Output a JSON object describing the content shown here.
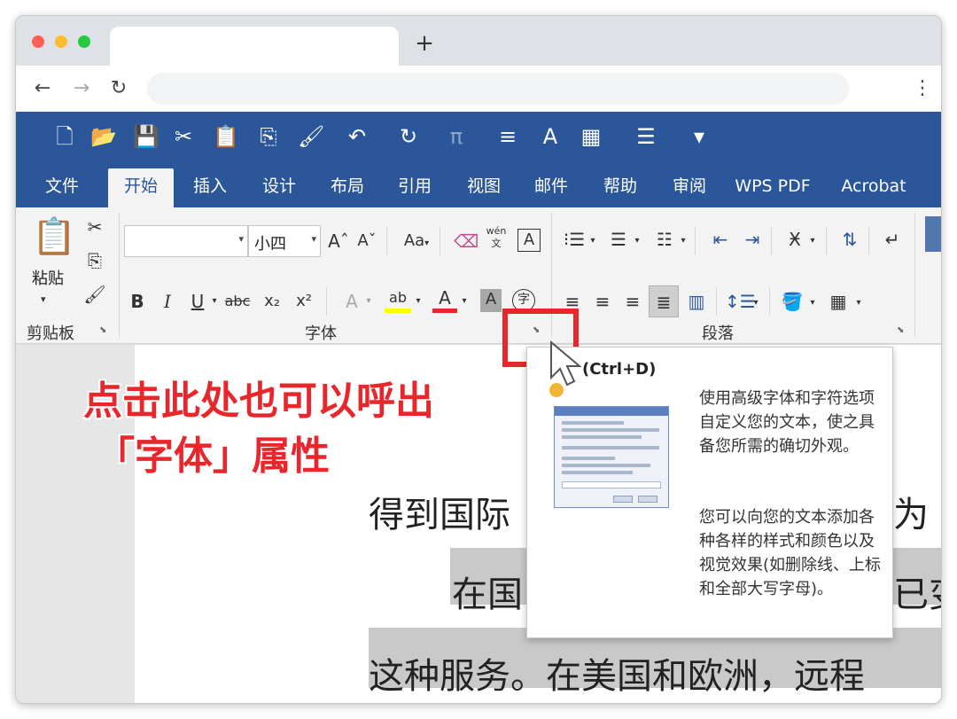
{
  "browser": {
    "new_tab_label": "+",
    "back_icon": "←",
    "forward_icon": "→",
    "reload_icon": "↻",
    "menu_icon": "⋮"
  },
  "quick_access": [
    {
      "name": "new-doc-icon",
      "glyph": "🗋"
    },
    {
      "name": "open-folder-icon",
      "glyph": "📂"
    },
    {
      "name": "save-icon",
      "glyph": "💾"
    },
    {
      "name": "cut-icon",
      "glyph": "✂"
    },
    {
      "name": "paste-icon",
      "glyph": "📋"
    },
    {
      "name": "copy-icon",
      "glyph": "⎘"
    },
    {
      "name": "format-painter-icon",
      "glyph": "🖌"
    },
    {
      "name": "undo-icon",
      "glyph": "↶"
    },
    {
      "name": "redo-icon",
      "glyph": "↻"
    },
    {
      "name": "equation-icon",
      "glyph": "π"
    },
    {
      "name": "align-icon",
      "glyph": "≡"
    },
    {
      "name": "spelling-icon",
      "glyph": "A"
    },
    {
      "name": "table-icon",
      "glyph": "▦"
    },
    {
      "name": "document-icon",
      "glyph": "☰"
    },
    {
      "name": "customize-icon",
      "glyph": "▾"
    }
  ],
  "menu_tabs": [
    "文件",
    "开始",
    "插入",
    "设计",
    "布局",
    "引用",
    "视图",
    "邮件",
    "帮助",
    "审阅",
    "WPS PDF",
    "Acrobat"
  ],
  "active_tab": "开始",
  "clipboard": {
    "paste_label": "粘贴",
    "group_name": "剪贴板"
  },
  "font": {
    "font_name_value": "",
    "font_size_value": "小四",
    "case_label": "Aa",
    "phonetic_label": "wén 文",
    "group_name": "字体",
    "bold": "B",
    "italic": "I",
    "underline": "U",
    "strikethrough": "abc",
    "subscript": "x₂",
    "superscript": "x²",
    "font_color": "A",
    "highlight": "ab",
    "char_shading": "A",
    "enclose_char": "字"
  },
  "paragraph": {
    "group_name": "段落"
  },
  "annotation": {
    "line1": "点击此处也可以呼出",
    "line2": "「字体」属性"
  },
  "document": {
    "line1": "得到国际",
    "line1_right": "为",
    "line2": "在国",
    "line2_right": "已变",
    "line3": "这种服务。在美国和欧洲，远程"
  },
  "tooltip": {
    "shortcut": "(Ctrl+D)",
    "para1": "使用高级字体和字符选项自定义您的文本，使之具备您所需的确切外观。",
    "para2": "您可以向您的文本添加各种各样的样式和颜色以及视觉效果(如删除线、上标和全部大写字母)。"
  },
  "colors": {
    "word_blue": "#2b579a",
    "annotation_red": "#e8262b",
    "ribbon_bg": "#f3f3f3"
  }
}
